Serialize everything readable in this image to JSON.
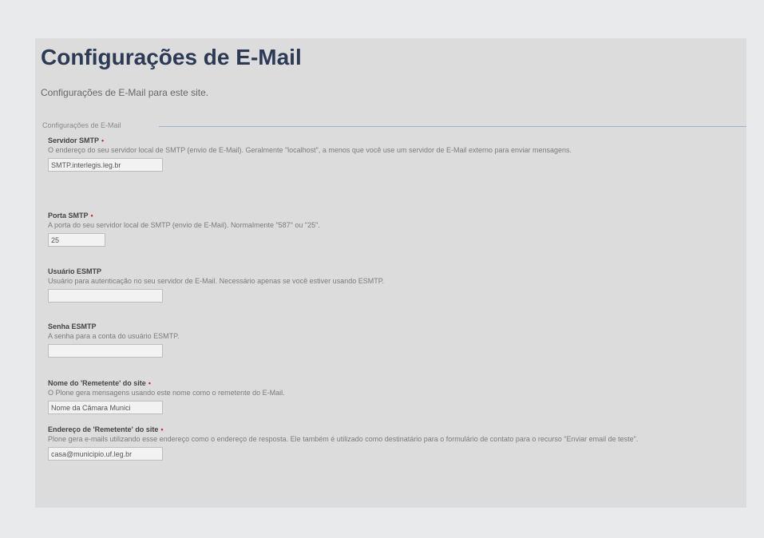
{
  "page": {
    "title": "Configurações de E-Mail",
    "description": "Configurações de E-Mail para este site."
  },
  "fieldset": {
    "legend": "Configurações de E-Mail"
  },
  "fields": [
    {
      "label": "Servidor SMTP",
      "required_mark": "•",
      "help": "O endereço do seu servidor local de SMTP (envio de E-Mail). Geralmente \"localhost\", a menos que você use um servidor de E-Mail externo para enviar mensagens.",
      "value": "SMTP.interlegis.leg.br"
    },
    {
      "label": "Porta SMTP",
      "required_mark": "•",
      "help": "A porta do seu servidor local de SMTP (envio de E-Mail). Normalmente \"587\" ou \"25\".",
      "value": "25"
    },
    {
      "label": "Usuário ESMTP",
      "required_mark": "",
      "help": "Usuário para autenticação no seu servidor de E-Mail. Necessário apenas se você estiver usando ESMTP.",
      "value": ""
    },
    {
      "label": "Senha ESMTP",
      "required_mark": "",
      "help": "A senha para a conta do usuário ESMTP.",
      "value": ""
    },
    {
      "label": "Nome do 'Remetente' do site",
      "required_mark": "•",
      "help": "O Plone gera mensagens usando este nome como o remetente do E-Mail.",
      "value": "Nome da Câmara Munici"
    },
    {
      "label": "Endereço de 'Remetente' do site",
      "required_mark": "•",
      "help": "Plone gera e-mails utilizando esse endereço como o endereço de resposta. Ele também é utilizado como destinatário para o formulário de contato para o recurso \"Enviar email de teste\".",
      "value": "casa@municipio.uf.leg.br"
    }
  ]
}
